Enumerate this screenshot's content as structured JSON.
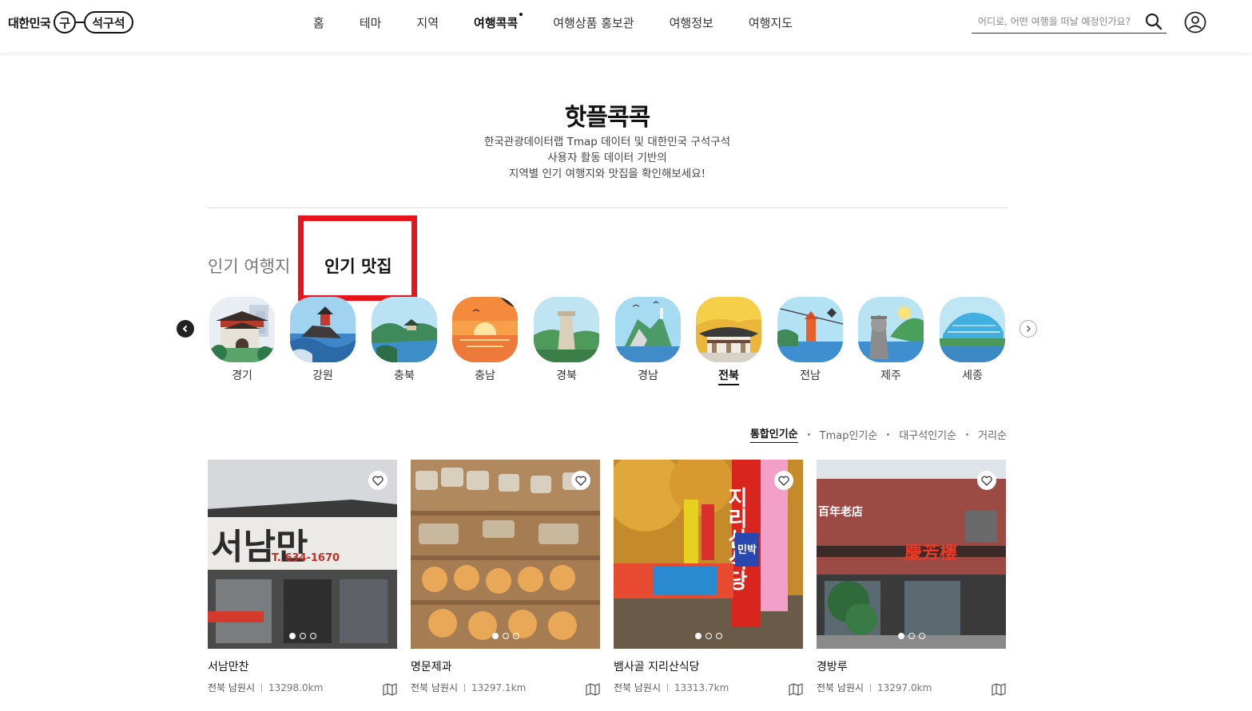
{
  "header": {
    "logo_text": "대한민국",
    "logo_mark_1": "구",
    "logo_mark_2": "석구석",
    "nav": [
      {
        "label": "홈"
      },
      {
        "label": "테마"
      },
      {
        "label": "지역"
      },
      {
        "label": "여행콕콕",
        "active": true
      },
      {
        "label": "여행상품 홍보관"
      },
      {
        "label": "여행정보"
      },
      {
        "label": "여행지도"
      }
    ],
    "search_placeholder": "어디로, 어떤 여행을 떠날 예정인가요?",
    "icons": {
      "search": "search-icon",
      "user": "user-icon"
    }
  },
  "main": {
    "title": "핫플콕콕",
    "desc": [
      "한국관광데이터랩 Tmap 데이터 및 대한민국 구석구석",
      "사용자 활동 데이터 기반의",
      "지역별 인기 여행지와 맛집을 확인해보세요!"
    ],
    "tabs": [
      {
        "label": "인기 여행지"
      },
      {
        "label": "인기 맛집",
        "active": true
      }
    ],
    "highlight_color": "#e8141c"
  },
  "regions": [
    {
      "label": "경기"
    },
    {
      "label": "강원"
    },
    {
      "label": "충북"
    },
    {
      "label": "충남"
    },
    {
      "label": "경북"
    },
    {
      "label": "경남"
    },
    {
      "label": "전북",
      "active": true
    },
    {
      "label": "전남"
    },
    {
      "label": "제주"
    },
    {
      "label": "세종"
    }
  ],
  "sort": [
    {
      "label": "통합인기순",
      "active": true
    },
    {
      "label": "Tmap인기순"
    },
    {
      "label": "대구석인기순"
    },
    {
      "label": "거리순"
    }
  ],
  "cards": [
    {
      "name": "서남만찬",
      "region": "전북 남원시",
      "distance": "13298.0km",
      "sign_text": "서남만",
      "phone": "T. 634-1670"
    },
    {
      "name": "명문제과",
      "region": "전북 남원시",
      "distance": "13297.1km"
    },
    {
      "name": "뱀사골 지리산식당",
      "region": "전북 남원시",
      "distance": "13313.7km",
      "sign_text": "지리산식당",
      "sub_sign": "민박"
    },
    {
      "name": "경방루",
      "region": "전북 남원시",
      "distance": "13297.0km",
      "sign_text": "慶芳樓",
      "sub_sign": "百年老店"
    }
  ]
}
